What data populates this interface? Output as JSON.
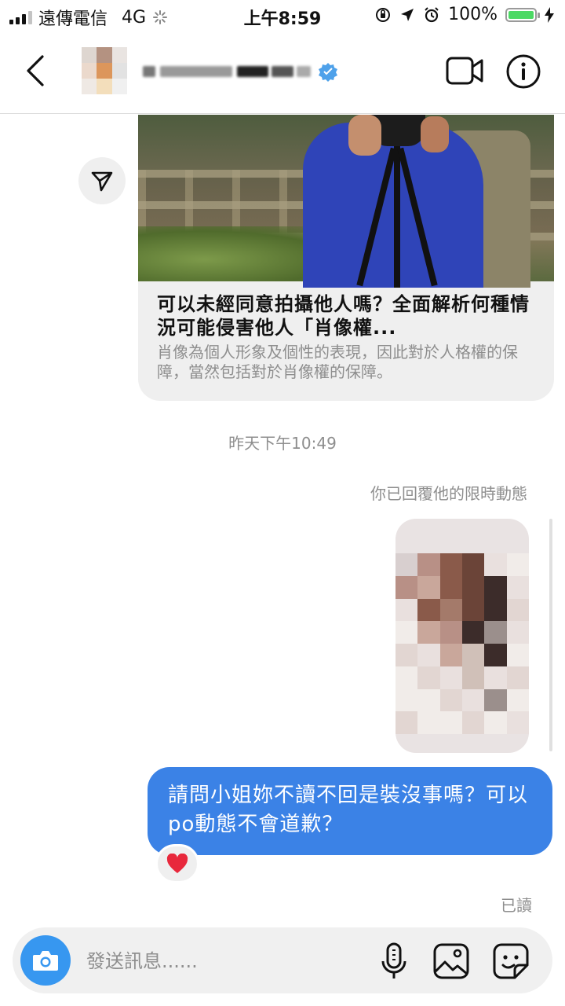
{
  "status_bar": {
    "carrier": "遠傳電信",
    "network": "4G",
    "time": "上午8:59",
    "battery_percent": "100%",
    "battery_level": 1.0
  },
  "header": {
    "back_icon": "chevron-left-icon",
    "video_icon": "video-camera-icon",
    "info_icon": "info-icon"
  },
  "link_card": {
    "title": "可以未經同意拍攝他人嗎？全面解析何種情況可能侵害他人「肖像權...",
    "description": "肖像為個人形象及個性的表現，因此對於人格權的保障，當然包括對於肖像權的保障。",
    "share_icon": "paper-plane-icon"
  },
  "timestamp": "昨天下午10:49",
  "story_reply_note": "你已回覆他的限時動態",
  "sent_message": {
    "text": "請問小姐妳不讀不回是裝沒事嗎？可以po動態不會道歉？",
    "reaction": "❤️"
  },
  "read_receipt": "已讀",
  "composer": {
    "placeholder": "發送訊息......",
    "icons": [
      "camera-icon",
      "microphone-icon",
      "gallery-icon",
      "sticker-icon"
    ],
    "accent_color": "#3797f0"
  },
  "colors": {
    "sent_bubble": "#3b82e6",
    "received_bg": "#efefef",
    "muted_text": "#8e8e8e"
  }
}
